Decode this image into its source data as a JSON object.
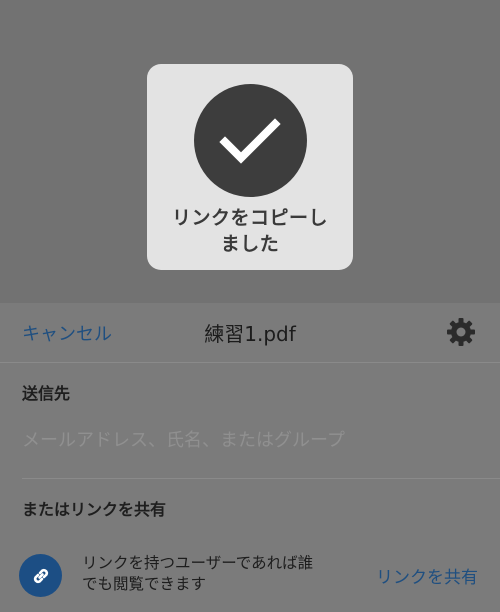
{
  "toast": {
    "message_line1": "リンクをコピーし",
    "message_line2": "ました"
  },
  "header": {
    "cancel_label": "キャンセル",
    "file_title": "練習1.pdf"
  },
  "recipients": {
    "label": "送信先",
    "placeholder": "メールアドレス、氏名、またはグループ"
  },
  "share": {
    "label": "またはリンクを共有",
    "description_line1": "リンクを持つユーザーであれば誰",
    "description_line2": "でも閲覧できます",
    "share_link_label": "リンクを共有"
  },
  "icons": {
    "toast": "checkmark-icon",
    "settings": "gear-icon",
    "link": "link-icon"
  },
  "colors": {
    "accent": "#1f4f80",
    "toast_bg": "#e3e3e3",
    "check_circle": "#3d3d3d"
  }
}
